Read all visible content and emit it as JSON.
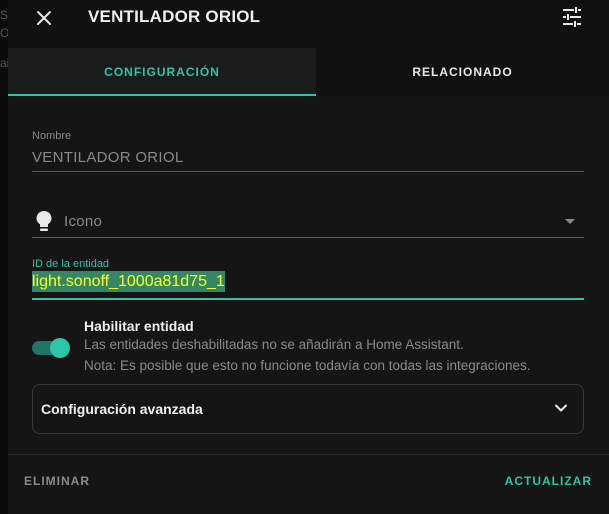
{
  "background": {
    "ghost_lines": [
      "S",
      "ON",
      "ai"
    ]
  },
  "header": {
    "title": "VENTILADOR ORIOL",
    "close_icon": "close-icon",
    "settings_icon": "tune-icon"
  },
  "tabs": [
    {
      "label": "CONFIGURACIÓN",
      "active": true
    },
    {
      "label": "RELACIONADO",
      "active": false
    }
  ],
  "form": {
    "name": {
      "label": "Nombre",
      "value": "VENTILADOR ORIOL"
    },
    "icon": {
      "placeholder": "Icono",
      "icon": "lightbulb-icon"
    },
    "entity_id": {
      "label": "ID de la entidad",
      "value": "light.sonoff_1000a81d75_1"
    },
    "enable": {
      "title": "Habilitar entidad",
      "enabled": true,
      "description": "Las entidades deshabilitadas no se añadirán a Home Assistant.",
      "note": "Nota: Es posible que esto no funcione todavía con todas las integraciones."
    },
    "advanced": {
      "label": "Configuración avanzada",
      "icon": "chevron-down-icon"
    }
  },
  "footer": {
    "delete_label": "ELIMINAR",
    "update_label": "ACTUALIZAR"
  },
  "colors": {
    "accent": "#2ec4a6",
    "background": "#151515",
    "muted_text": "#8a8a8a"
  }
}
